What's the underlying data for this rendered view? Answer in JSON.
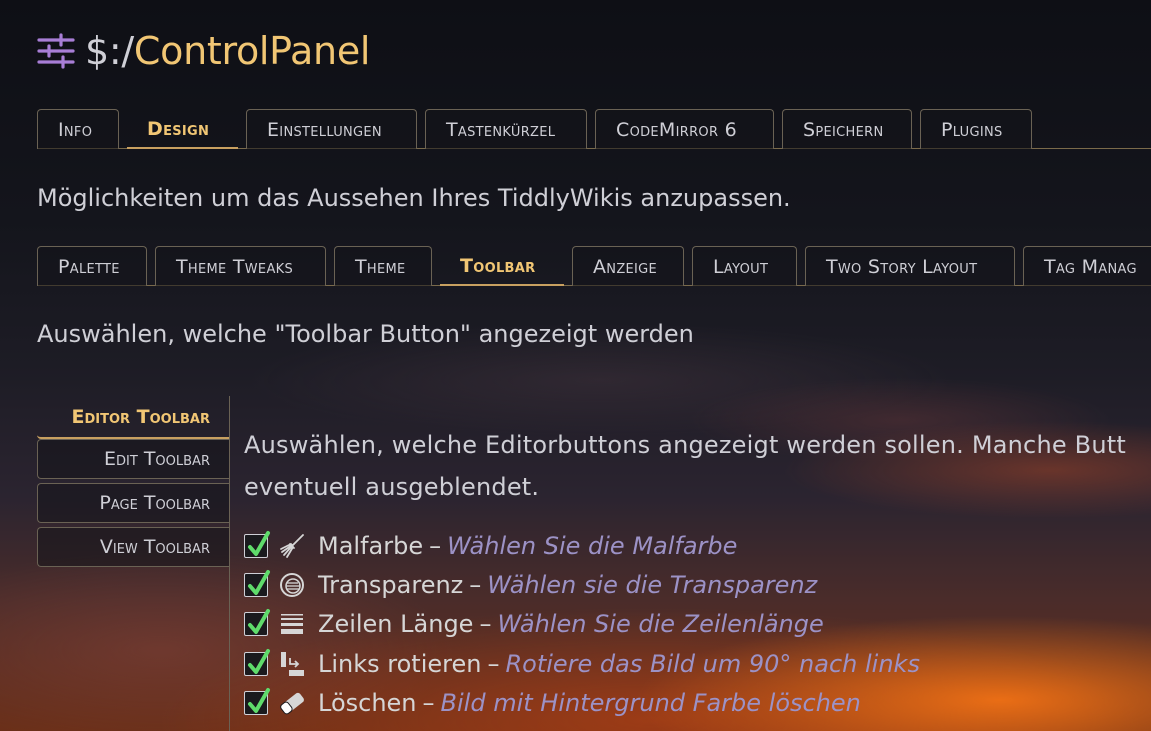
{
  "header": {
    "prefix": "$:/",
    "name": "ControlPanel",
    "icon": "sliders-icon"
  },
  "main_tabs": [
    {
      "label": "Info",
      "active": false
    },
    {
      "label": "Design",
      "active": true
    },
    {
      "label": "Einstellungen",
      "active": false
    },
    {
      "label": "Tastenkürzel",
      "active": false
    },
    {
      "label": "CodeMirror 6",
      "active": false
    },
    {
      "label": "Speichern",
      "active": false
    },
    {
      "label": "Plugins",
      "active": false
    }
  ],
  "design": {
    "description": "Möglichkeiten um das Aussehen Ihres TiddlyWikis anzupassen.",
    "tabs": [
      {
        "label": "Palette",
        "active": false
      },
      {
        "label": "Theme Tweaks",
        "active": false
      },
      {
        "label": "Theme",
        "active": false
      },
      {
        "label": "Toolbar",
        "active": true
      },
      {
        "label": "Anzeige",
        "active": false
      },
      {
        "label": "Layout",
        "active": false
      },
      {
        "label": "Two Story Layout",
        "active": false
      },
      {
        "label": "Tag Manag",
        "active": false
      }
    ]
  },
  "toolbar": {
    "description": "Auswählen, welche \"Toolbar Button\" angezeigt werden",
    "side_tabs": [
      {
        "label": "Editor Toolbar",
        "active": true
      },
      {
        "label": "Edit Toolbar",
        "active": false
      },
      {
        "label": "Page Toolbar",
        "active": false
      },
      {
        "label": "View Toolbar",
        "active": false
      }
    ],
    "intro_line1": "Auswählen, welche Editorbuttons angezeigt werden sollen. Manche Butt",
    "intro_line2": "eventuell ausgeblendet.",
    "buttons": [
      {
        "name": "Malfarbe",
        "desc": "Wählen Sie die Malfarbe",
        "icon": "paint-brush-icon",
        "checked": true
      },
      {
        "name": "Transparenz",
        "desc": "Wählen sie die Transparenz",
        "icon": "opacity-icon",
        "checked": true
      },
      {
        "name": "Zeilen Länge",
        "desc": "Wählen Sie die Zeilenlänge",
        "icon": "line-width-icon",
        "checked": true
      },
      {
        "name": "Links rotieren",
        "desc": "Rotiere das Bild um 90° nach links",
        "icon": "rotate-left-icon",
        "checked": true
      },
      {
        "name": "Löschen",
        "desc": "Bild mit Hintergrund Farbe löschen",
        "icon": "eraser-icon",
        "checked": true
      }
    ]
  },
  "colors": {
    "accent": "#f1c674",
    "text": "#cfcfd6",
    "description": "#9c92c6",
    "check": "#5fdb6b",
    "icon_purple": "#a87ed6"
  }
}
